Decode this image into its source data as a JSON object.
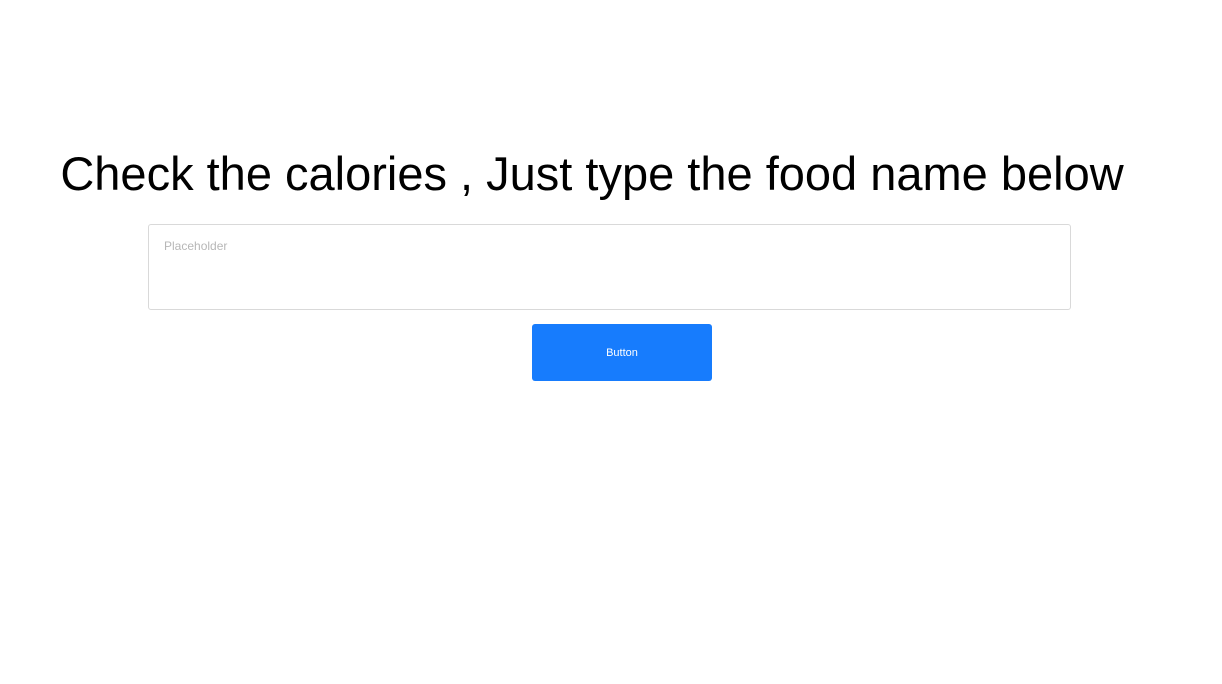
{
  "main": {
    "heading": "Check the calories , Just type the food name below",
    "food_input": {
      "value": "",
      "placeholder": "Placeholder"
    },
    "submit_button": {
      "label": "Button"
    }
  },
  "colors": {
    "button_background": "#177cfd",
    "button_text": "#ffffff",
    "input_border": "#d9d9d9",
    "placeholder_text": "#b7b7b7"
  }
}
